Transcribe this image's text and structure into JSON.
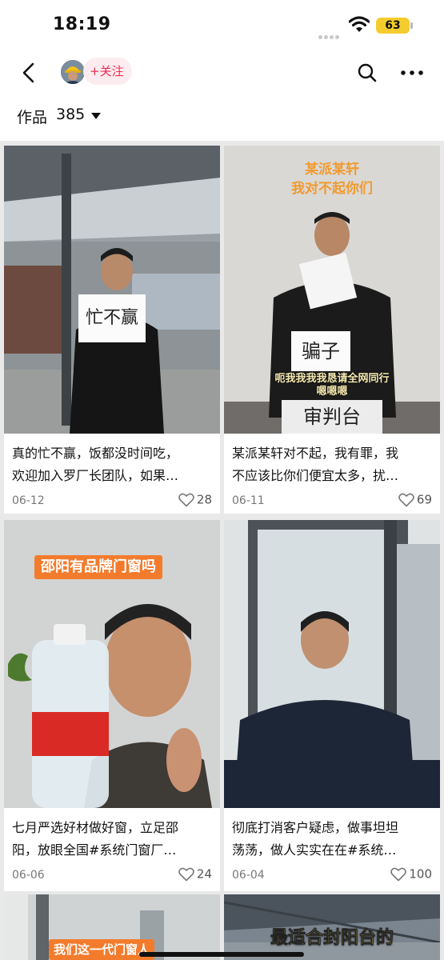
{
  "status_bar": {
    "time": "18:19",
    "battery": "63"
  },
  "header": {
    "follow_label": "+关注"
  },
  "works": {
    "label": "作品",
    "count": "385"
  },
  "colors": {
    "accent": "#ee2c55",
    "follow_bg": "#fdecef",
    "overlay_orange": "#f37b2c",
    "battery": "#f5cc2e"
  },
  "videos": [
    {
      "title_line1": "真的忙不赢，饭都没时间吃，",
      "title_line2": "欢迎加入罗厂长团队，如果…",
      "date": "06-12",
      "likes": "28",
      "overlay": {
        "sign": "忙不赢"
      }
    },
    {
      "title_line1": "某派某轩对不起，我有罪，我",
      "title_line2": "不应该比你们便宜太多，扰…",
      "date": "06-11",
      "likes": "69",
      "overlay": {
        "top_line1": "某派某轩",
        "top_line2": "我对不起你们",
        "sign": "骗子",
        "subtitle_line1": "呃我我我我恳请全网同行",
        "subtitle_line2": "嗯嗯嗯",
        "podium": "审判台"
      }
    },
    {
      "title_line1": "七月严选好材做好窗，立足邵",
      "title_line2": "阳，放眼全国#系统门窗厂…",
      "date": "06-06",
      "likes": "24",
      "overlay": {
        "top_line1": "邵阳有品牌门窗吗"
      }
    },
    {
      "title_line1": "彻底打消客户疑虑，做事坦坦",
      "title_line2": "荡荡，做人实实在在#系统…",
      "date": "06-04",
      "likes": "100",
      "overlay": {}
    },
    {
      "overlay": {
        "top_line1": "我们这一代门窗人"
      }
    },
    {
      "overlay": {
        "top_line1": "最适合封阳台的"
      }
    }
  ]
}
